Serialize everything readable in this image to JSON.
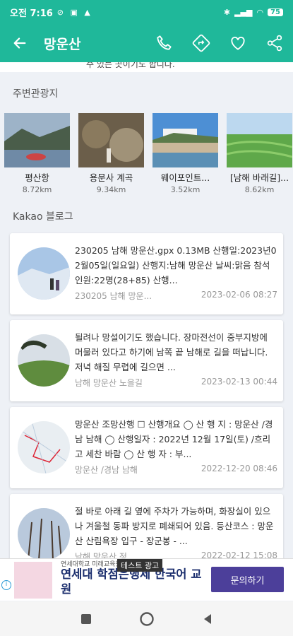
{
  "status_bar": {
    "time": "오전 7:16",
    "battery": "75"
  },
  "app_bar": {
    "title": "망운산"
  },
  "cut_text": "수 있는 곳이기도 합니다.",
  "nearby": {
    "title": "주변관광지",
    "places": [
      {
        "name": "평산항",
        "distance": "8.72km"
      },
      {
        "name": "용문사 계곡",
        "distance": "9.34km"
      },
      {
        "name": "웨이포인트...",
        "distance": "3.52km"
      },
      {
        "name": "[남해 바래길]...",
        "distance": "8.62km"
      }
    ]
  },
  "blog": {
    "title": "Kakao 블로그",
    "posts": [
      {
        "text": "230205 남해 망운산.gpx 0.13MB 산행일:2023년02월05일(일요일) 산행지:남해 망운산 날씨:맑음 참석인원:22명(28+85) 산행...",
        "source": "230205 남해 망운...",
        "date": "2023-02-06 08:27"
      },
      {
        "text": "될려나 망설이기도 했습니다. 장마전선이 중부지방에 머물러 있다고 하기에 남쪽 끝 남해로 길을 떠납니다. 저녁 해질 무렵에 길으면 ...",
        "source": "남해 망운산 노을길",
        "date": "2023-02-13 00:44"
      },
      {
        "text": "망운산 조망산행 ☐ 산행개요 ◯ 산 행 지 : 망운산 /경남 남해 ◯ 산행일자 : 2022년 12월 17일(토) /흐리고 세찬 바람 ◯ 산 행 자 : 부...",
        "source": "망운산 /경남 남해",
        "date": "2022-12-20 08:46"
      },
      {
        "text": "절 바로 아래 길 옆에 주차가 가능하며, 화장실이 있으나 겨울철 동파 방지로 폐쇄되어 있음. 등산코스 : 망운산 산림욕장 입구 - 장군봉 - ...",
        "source": "남해 망운산 정...",
        "date": "2022-02-12 15:08"
      }
    ]
  },
  "ad": {
    "small": "연세대학교 미래교육원",
    "headline": "연세대 학점은행제 한국어 교원",
    "label": "테스트 광고",
    "cta": "문의하기"
  },
  "colors": {
    "accent": "#1fb89a",
    "ad_cta": "#4c3f9a"
  }
}
